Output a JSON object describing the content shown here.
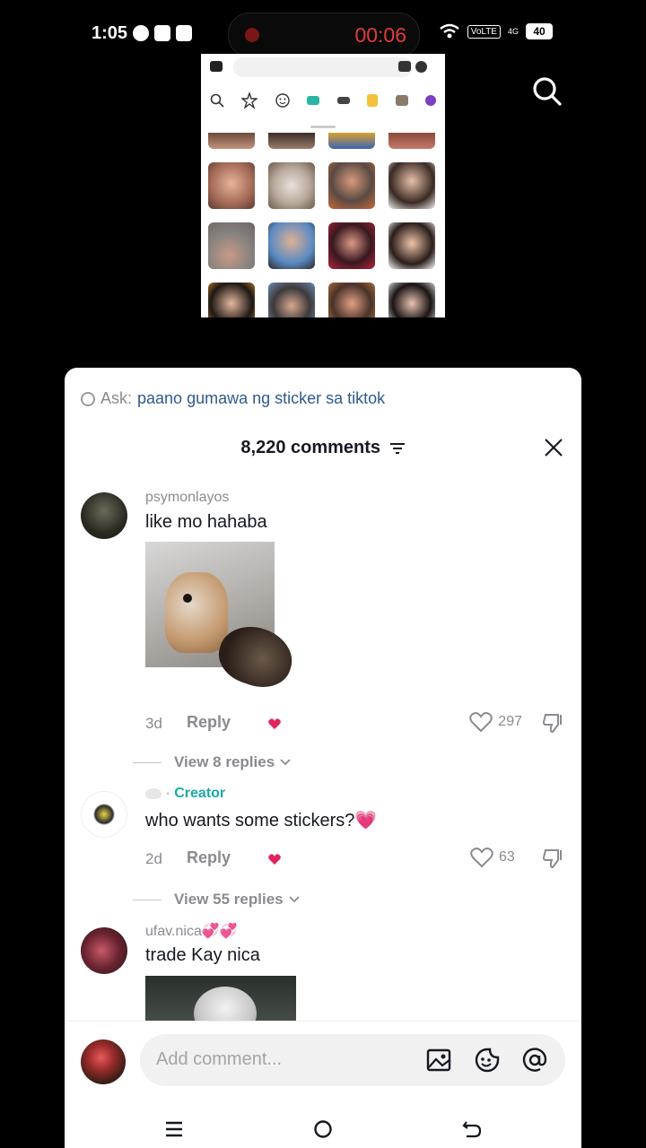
{
  "status_bar": {
    "time": "1:05",
    "recording_time": "00:06",
    "network_badge": "VoLTE",
    "signal_label": "4G",
    "battery": "40"
  },
  "comments_sheet": {
    "ask_label": "Ask:",
    "ask_query": "paano gumawa ng sticker sa tiktok",
    "comment_count": "8,220 comments",
    "comments": [
      {
        "username": "psymonlayos",
        "text": "like mo hahaba",
        "age": "3d",
        "reply_label": "Reply",
        "likes": "297",
        "view_replies": "View 8 replies"
      },
      {
        "username_badge": "Creator",
        "username_prefix": "· ",
        "text": "who wants some stickers?💗",
        "age": "2d",
        "reply_label": "Reply",
        "likes": "63",
        "view_replies": "View 55 replies"
      },
      {
        "username": "ufav.nica💞💞",
        "text": "trade Kay nica"
      }
    ],
    "add_comment_placeholder": "Add comment..."
  },
  "colors": {
    "accent_creator": "#1aa9a7",
    "ask_link": "#2f5a8c",
    "recording_red": "#e23b3b"
  }
}
